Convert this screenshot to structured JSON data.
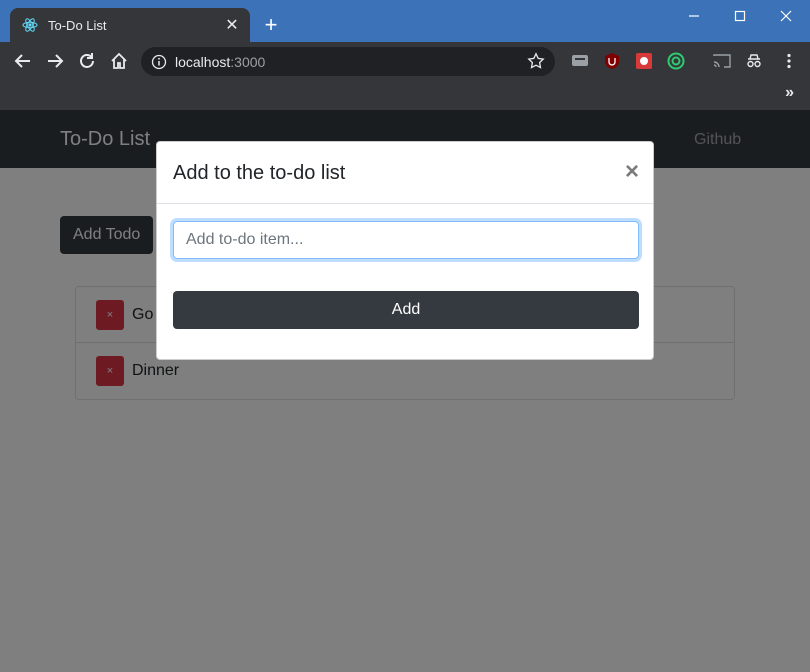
{
  "browser": {
    "tab_title": "To-Do List",
    "new_tab_symbol": "+",
    "close_tab_symbol": "✕",
    "url_host": "localhost",
    "url_port": ":3000",
    "bookmarks_overflow": "»"
  },
  "app": {
    "brand": "To-Do List",
    "nav_link": "Github",
    "add_todo_button": "Add Todo",
    "todos": [
      {
        "text": "Go",
        "delete_symbol": "×"
      },
      {
        "text": "Dinner",
        "delete_symbol": "×"
      }
    ]
  },
  "modal": {
    "title": "Add to the to-do list",
    "close_symbol": "×",
    "input_placeholder": "Add to-do item...",
    "input_value": "",
    "submit_label": "Add"
  },
  "colors": {
    "titlebar": "#3c73b8",
    "chrome_dark": "#35363a",
    "navbar": "#343a40",
    "danger": "#dc3545",
    "focus_ring": "#80bdff"
  },
  "icons": {
    "favicon": "react-icon",
    "back": "back-arrow-icon",
    "forward": "forward-arrow-icon",
    "reload": "reload-icon",
    "home": "home-icon",
    "site_info": "info-icon",
    "bookmark": "star-icon"
  }
}
